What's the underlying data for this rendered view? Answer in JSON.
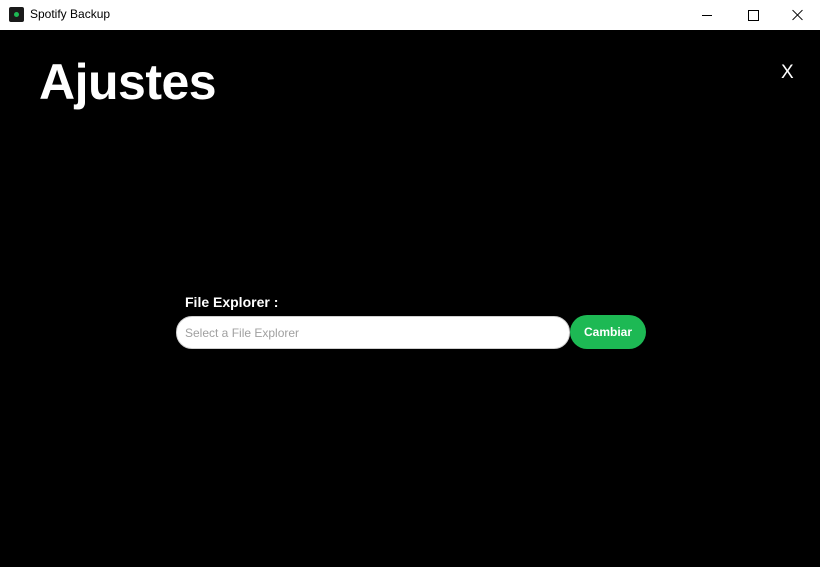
{
  "window": {
    "title": "Spotify Backup",
    "icon": "spotify-backup-app-icon",
    "controls": {
      "minimize_icon": "minimize-icon",
      "maximize_icon": "maximize-icon",
      "close_icon": "close-icon"
    }
  },
  "settings": {
    "title": "Ajustes",
    "close_label": "X",
    "file_explorer": {
      "label": "File Explorer :",
      "value": "",
      "placeholder": "Select a File Explorer",
      "button_label": "Cambiar"
    }
  },
  "colors": {
    "background": "#000000",
    "accent": "#1DB954",
    "text": "#ffffff",
    "titlebar": "#ffffff"
  }
}
